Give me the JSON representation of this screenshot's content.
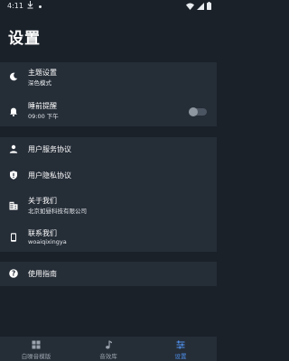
{
  "status_bar": {
    "time": "4:11",
    "icons": [
      "download-icon",
      "dot-icon",
      "wifi-icon",
      "signal-icon",
      "battery-icon"
    ]
  },
  "page": {
    "title": "设置"
  },
  "settings": {
    "theme": {
      "label": "主题设置",
      "value": "深色模式",
      "icon": "moon-icon"
    },
    "sleep_reminder": {
      "label": "睡前提醒",
      "value": "09:00 下午",
      "icon": "bell-icon",
      "enabled": false
    },
    "service_agreement": {
      "label": "用户服务协议",
      "icon": "person-icon"
    },
    "privacy_agreement": {
      "label": "用户隐私协议",
      "icon": "shield-icon"
    },
    "about": {
      "label": "关于我们",
      "value": "北京如昼科技有限公司",
      "icon": "building-icon"
    },
    "contact": {
      "label": "联系我们",
      "value": "woaiqixingya",
      "icon": "phone-icon"
    },
    "guide": {
      "label": "使用指南",
      "icon": "help-icon"
    }
  },
  "bottom_nav": {
    "items": [
      {
        "label": "白噪音模版",
        "icon": "grid-icon",
        "active": false
      },
      {
        "label": "音效库",
        "icon": "music-note-icon",
        "active": false
      },
      {
        "label": "设置",
        "icon": "sliders-icon",
        "active": true
      }
    ]
  },
  "colors": {
    "background": "#1a2129",
    "card": "#252d37",
    "accent": "#4e8fe8"
  }
}
